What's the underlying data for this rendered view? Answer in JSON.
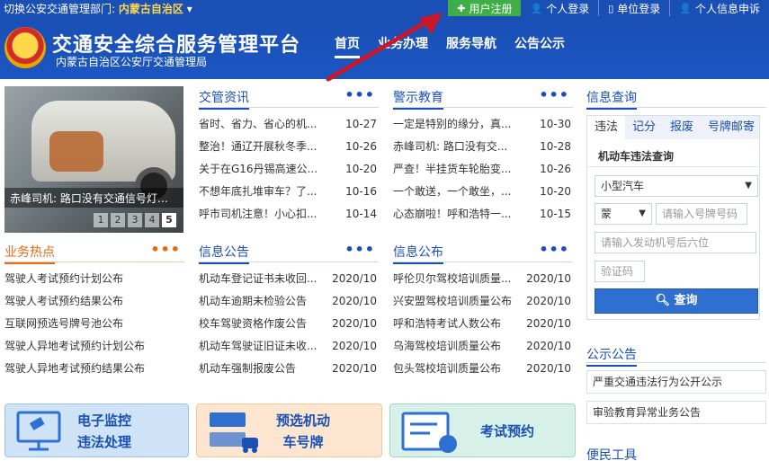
{
  "topbar": {
    "switch_label": "切换公安交通管理部门:",
    "region": "内蒙古自治区",
    "region_caret": "▾",
    "buttons": [
      {
        "icon": "plus-icon",
        "glyph": "✚",
        "label": "用户注册"
      },
      {
        "icon": "user-icon",
        "glyph": "👤",
        "label": "个人登录"
      },
      {
        "icon": "document-icon",
        "glyph": "▯",
        "label": "单位登录"
      },
      {
        "icon": "user-icon",
        "glyph": "👤",
        "label": "个人信息申诉"
      }
    ]
  },
  "header": {
    "title": "交通安全综合服务管理平台",
    "subtitle": "内蒙古自治区公安厅交通管理局",
    "nav": [
      "首页",
      "业务办理",
      "服务导航",
      "公告公示"
    ]
  },
  "photo": {
    "caption": "赤峰司机: 路口没有交通信号灯，...",
    "pages": [
      "1",
      "2",
      "3",
      "4",
      "5"
    ],
    "active_page": "5"
  },
  "news": {
    "title": "交管资讯",
    "more": "•••",
    "items": [
      {
        "title": "省时、省力、省心的机...",
        "date": "10-27"
      },
      {
        "title": "整治！通辽开展秋冬季...",
        "date": "10-26"
      },
      {
        "title": "关于在G16丹锡高速公...",
        "date": "10-20"
      },
      {
        "title": "不想年底扎堆审车？了...",
        "date": "10-16"
      },
      {
        "title": "呼市司机注意！小心扣...",
        "date": "10-14"
      }
    ]
  },
  "warning": {
    "title": "警示教育",
    "more": "•••",
    "items": [
      {
        "title": "一定是特别的缘分，真...",
        "date": "10-30"
      },
      {
        "title": "赤峰司机: 路口没有交...",
        "date": "10-28"
      },
      {
        "title": "严查！半挂货车轮胎变...",
        "date": "10-26"
      },
      {
        "title": "一个敢送，一个敢坐，...",
        "date": "10-20"
      },
      {
        "title": "心态崩啦！呼和浩特一...",
        "date": "10-15"
      }
    ]
  },
  "hot": {
    "title": "业务热点",
    "more": "•••",
    "items": [
      {
        "title": "驾驶人考试预约计划公布"
      },
      {
        "title": "驾驶人考试预约结果公布"
      },
      {
        "title": "互联网预选号牌号池公布"
      },
      {
        "title": "驾驶人异地考试预约计划公布"
      },
      {
        "title": "驾驶人异地考试预约结果公布"
      }
    ]
  },
  "info_notice": {
    "title": "信息公告",
    "more": "•••",
    "items": [
      {
        "title": "机动车登记证书未收回...",
        "date": "2020/10"
      },
      {
        "title": "机动车逾期未检验公告",
        "date": "2020/10"
      },
      {
        "title": "校车驾驶资格作废公告",
        "date": "2020/10"
      },
      {
        "title": "机动车驾驶证旧证未收...",
        "date": "2020/10"
      },
      {
        "title": "机动车强制报废公告",
        "date": "2020/10"
      }
    ]
  },
  "info_publish": {
    "title": "信息公布",
    "more": "•••",
    "items": [
      {
        "title": "呼伦贝尔驾校培训质量...",
        "date": "2020/10"
      },
      {
        "title": "兴安盟驾校培训质量公布",
        "date": "2020/10"
      },
      {
        "title": "呼和浩特考试人数公布",
        "date": "2020/10"
      },
      {
        "title": "乌海驾校培训质量公布",
        "date": "2020/10"
      },
      {
        "title": "包头驾校培训质量公布",
        "date": "2020/10"
      }
    ]
  },
  "query": {
    "section_title": "信息查询",
    "tabs": [
      "违法",
      "记分",
      "报废",
      "号牌邮寄"
    ],
    "active_tab": "违法",
    "form_title": "机动车违法查询",
    "vehicle_type": "小型汽车",
    "province": "蒙",
    "plate_placeholder": "请输入号牌号码",
    "engine_placeholder": "请输入发动机号后六位",
    "captcha_placeholder": "验证码",
    "submit": "查询"
  },
  "public_notice": {
    "title": "公示公告",
    "items": [
      "严重交通违法行为公开公示",
      "审验教育异常业务公告"
    ]
  },
  "bianmin": {
    "title": "便民工具"
  },
  "banners": [
    {
      "line1": "电子监控",
      "line2": "违法处理"
    },
    {
      "line1": "预选机动",
      "line2": "车号牌"
    },
    {
      "line1": "考试预约"
    }
  ],
  "colors": {
    "brand_blue": "#1a4fb5",
    "register_green": "#3fae49",
    "hot_orange": "#e46b14",
    "arrow_red": "#c8182a"
  }
}
